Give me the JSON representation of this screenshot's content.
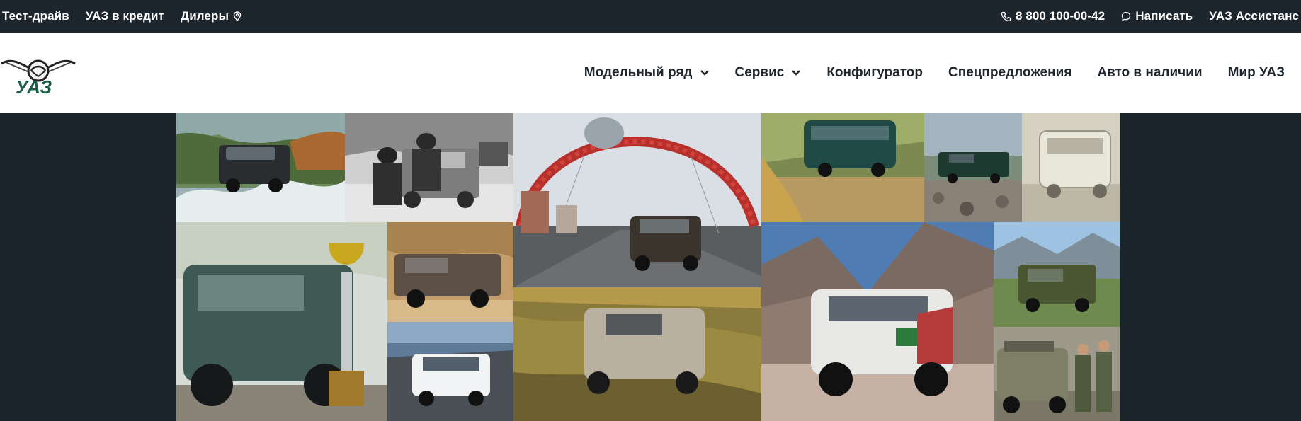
{
  "topbar": {
    "test_drive": "Тест-драйв",
    "credit": "УАЗ в кредит",
    "dealers": "Дилеры",
    "phone": "8 800 100-00-42",
    "write": "Написать",
    "assistance": "УАЗ Ассистанс"
  },
  "header": {
    "logo_text": "УАЗ",
    "nav": {
      "models": "Модельный ряд",
      "service": "Сервис",
      "configurator": "Конфигуратор",
      "offers": "Спецпредложения",
      "in_stock": "Авто в наличии",
      "world": "Мир УАЗ"
    }
  },
  "colors": {
    "dark_bg": "#1b232b",
    "brand_green": "#1c5f48",
    "nav_text": "#1f262d"
  },
  "icons": {
    "location": "location-pin-icon",
    "phone": "phone-icon",
    "chat": "chat-bubble-icon",
    "chevron": "chevron-down-icon",
    "logo": "uaz-logo-icon"
  }
}
